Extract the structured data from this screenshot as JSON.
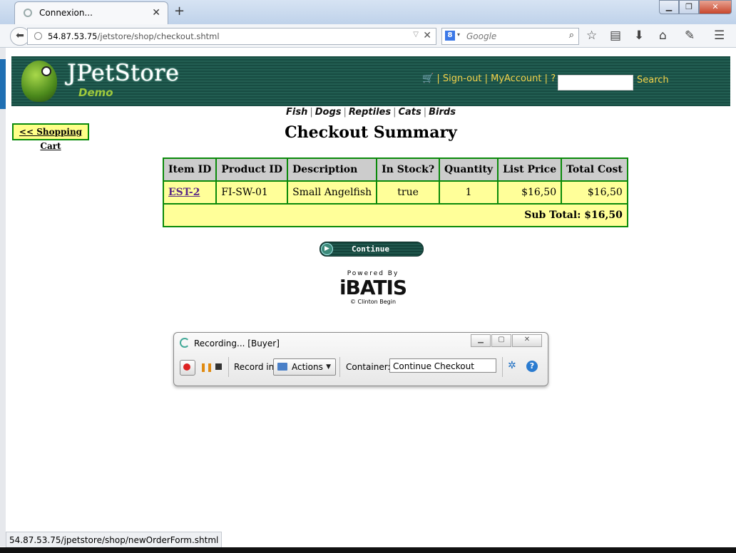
{
  "browser": {
    "tab_title": "Connexion...",
    "url_host": "54.87.53.75",
    "url_path": "/jetstore/shop/checkout.shtml",
    "search_engine": "Google",
    "status_url": "54.87.53.75/jpetstore/shop/newOrderForm.shtml"
  },
  "header": {
    "logo_title": "JPetStore",
    "logo_sub": "Demo",
    "sign_out": "Sign-out",
    "my_account": "MyAccount",
    "help": "?",
    "search_label": "Search",
    "sep": "|"
  },
  "categories": [
    "Fish",
    "Dogs",
    "Reptiles",
    "Cats",
    "Birds"
  ],
  "back_link": "<< Shopping Cart",
  "page_title": "Checkout Summary",
  "table": {
    "headers": [
      "Item ID",
      "Product ID",
      "Description",
      "In Stock?",
      "Quantity",
      "List Price",
      "Total Cost"
    ],
    "row": {
      "item_id": "EST-2",
      "product_id": "FI-SW-01",
      "description": "Small Angelfish",
      "in_stock": "true",
      "quantity": "1",
      "list_price": "$16,50",
      "total_cost": "$16,50"
    },
    "subtotal": "Sub Total: $16,50"
  },
  "continue_label": "Continue",
  "ibatis": {
    "top": "Powered By",
    "logo": "iBATIS",
    "bottom": "© Clinton Begin"
  },
  "recorder": {
    "title": "Recording... [Buyer]",
    "record_in_label": "Record in:",
    "record_in_value": "Actions",
    "container_label": "Container:",
    "container_value": "Continue Checkout"
  },
  "colors": {
    "header_green": "#184d43",
    "link_yellow": "#f5d34a",
    "table_border": "#0a8a0a",
    "cell_yellow": "#ffff99"
  }
}
